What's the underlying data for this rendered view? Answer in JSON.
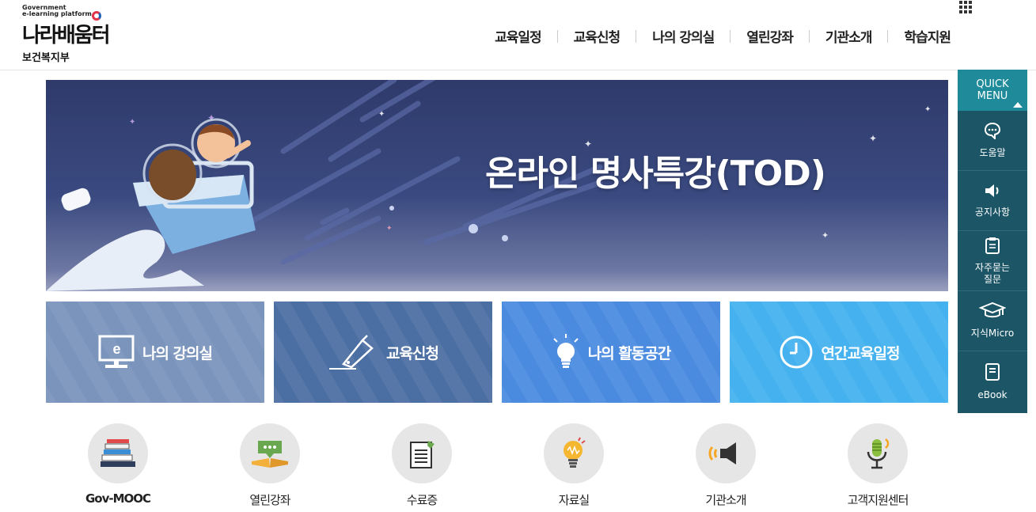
{
  "header": {
    "logo_en_line1": "Government",
    "logo_en_line2": "e-learning platform",
    "logo_ko": "나라배움터",
    "ministry": "보건복지부",
    "nav": [
      "교육일정",
      "교육신청",
      "나의 강의실",
      "열린강좌",
      "기관소개",
      "학습지원"
    ],
    "allmenu_icon": "grid-icon"
  },
  "banner": {
    "title": "온라인 명사특강(TOD)"
  },
  "tiles": [
    {
      "label": "나의 강의실",
      "icon": "monitor-e-icon",
      "color": "#7a94bb"
    },
    {
      "label": "교육신청",
      "icon": "pen-icon",
      "color": "#4b6fa3"
    },
    {
      "label": "나의 활동공간",
      "icon": "lightbulb-icon",
      "color": "#4a8be0"
    },
    {
      "label": "연간교육일정",
      "icon": "clock-icon",
      "color": "#45b1ee"
    }
  ],
  "quick_menu": {
    "title_line1": "QUICK",
    "title_line2": "MENU",
    "items": [
      {
        "label": "도움말",
        "icon": "chat-bubble-icon"
      },
      {
        "label": "공지사항",
        "icon": "speaker-icon"
      },
      {
        "label_line1": "자주묻는",
        "label_line2": "질문",
        "icon": "clipboard-icon"
      },
      {
        "label": "지식Micro",
        "icon": "graduation-cap-icon"
      },
      {
        "label": "eBook",
        "icon": "ebook-icon"
      }
    ]
  },
  "services": [
    {
      "label": "Gov-MOOC",
      "icon": "books-icon"
    },
    {
      "label": "열린강좌",
      "icon": "open-book-icon"
    },
    {
      "label": "수료증",
      "icon": "certificate-icon"
    },
    {
      "label": "자료실",
      "icon": "lightbulb-icon"
    },
    {
      "label": "기관소개",
      "icon": "megaphone-icon"
    },
    {
      "label": "고객지원센터",
      "icon": "microphone-icon"
    }
  ]
}
